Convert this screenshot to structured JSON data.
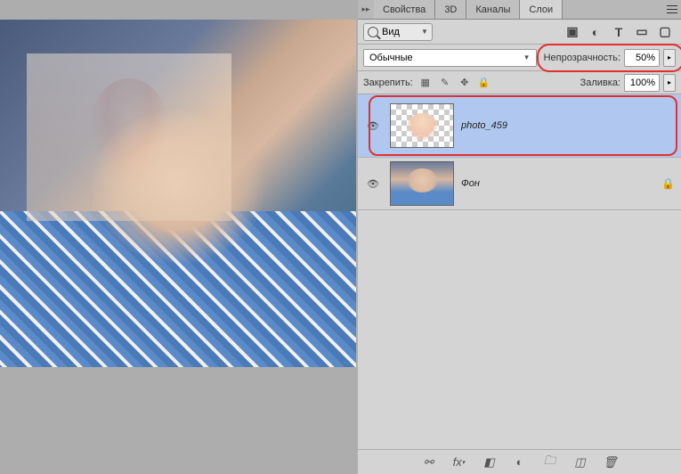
{
  "tabs": {
    "properties": "Свойства",
    "threeD": "3D",
    "channels": "Каналы",
    "layers": "Слои"
  },
  "filter": {
    "label": "Вид"
  },
  "blend": {
    "mode": "Обычные",
    "opacity_label": "Непрозрачность:",
    "opacity_value": "50%"
  },
  "lock": {
    "label": "Закрепить:",
    "fill_label": "Заливка:",
    "fill_value": "100%"
  },
  "layers": [
    {
      "name": "photo_459",
      "selected": true,
      "locked": false
    },
    {
      "name": "Фон",
      "selected": false,
      "locked": true
    }
  ],
  "icons": {
    "image_filter": "image-icon",
    "adjust_filter": "adjustment-icon",
    "type_filter": "type-icon",
    "shape_filter": "shape-icon",
    "smart_filter": "smart-icon",
    "lock_trans": "lock-transparency-icon",
    "lock_paint": "lock-paint-icon",
    "lock_move": "lock-move-icon",
    "lock_all": "lock-all-icon",
    "link": "link-icon",
    "fx": "fx-icon",
    "mask": "mask-icon",
    "adjustment": "adjustment-layer-icon",
    "group": "group-icon",
    "newlayer": "new-layer-icon",
    "trash": "trash-icon"
  }
}
